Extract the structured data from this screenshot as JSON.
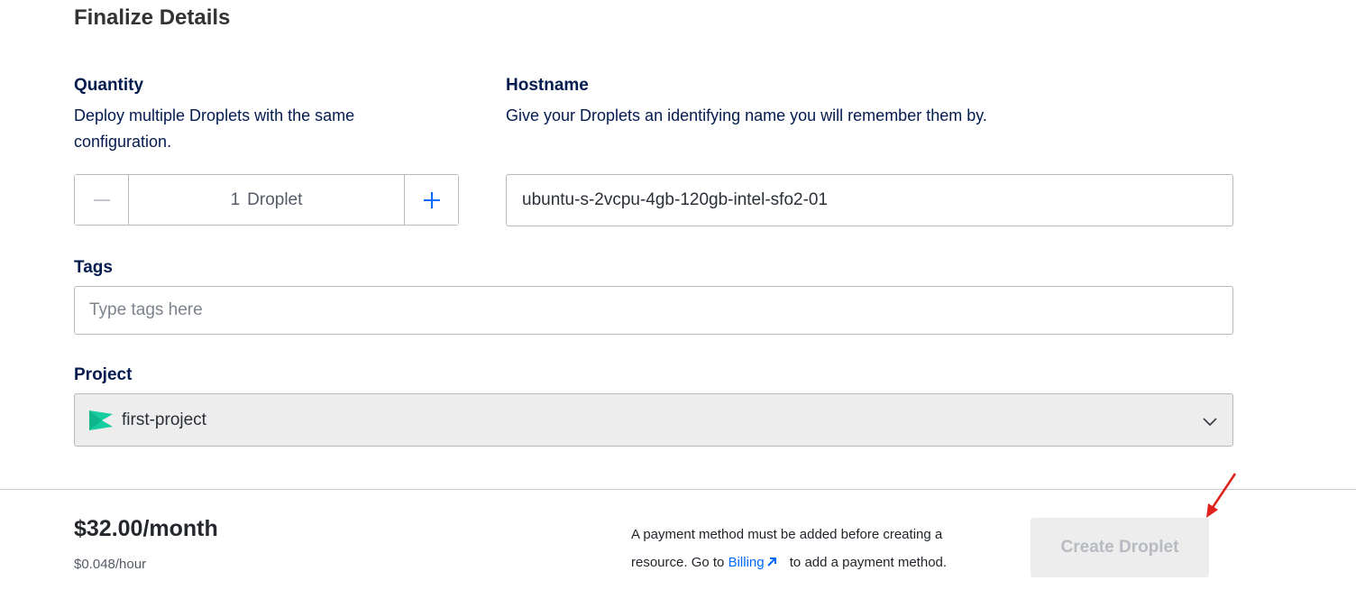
{
  "section": {
    "title": "Finalize Details"
  },
  "quantity": {
    "label": "Quantity",
    "description": "Deploy multiple Droplets with the same configuration.",
    "value": "1",
    "unit": "Droplet",
    "decrement_icon": "minus-icon",
    "increment_icon": "plus-icon"
  },
  "hostname": {
    "label": "Hostname",
    "description": "Give your Droplets an identifying name you will remember them by.",
    "value": "ubuntu-s-2vcpu-4gb-120gb-intel-sfo2-01"
  },
  "tags": {
    "label": "Tags",
    "placeholder": "Type tags here"
  },
  "project": {
    "label": "Project",
    "selected": "first-project",
    "icon": "project-icon",
    "icon_color": "#15cd9f"
  },
  "footer": {
    "price": "$32.00/month",
    "hourly": "$0.048/hour",
    "payment_note_prefix": "A payment method must be added before creating a resource. Go to",
    "billing_link": "Billing",
    "payment_note_suffix": "to add a payment method.",
    "create_button": "Create Droplet"
  },
  "colors": {
    "accent": "#0069ff",
    "annotation": "#e0201b"
  }
}
